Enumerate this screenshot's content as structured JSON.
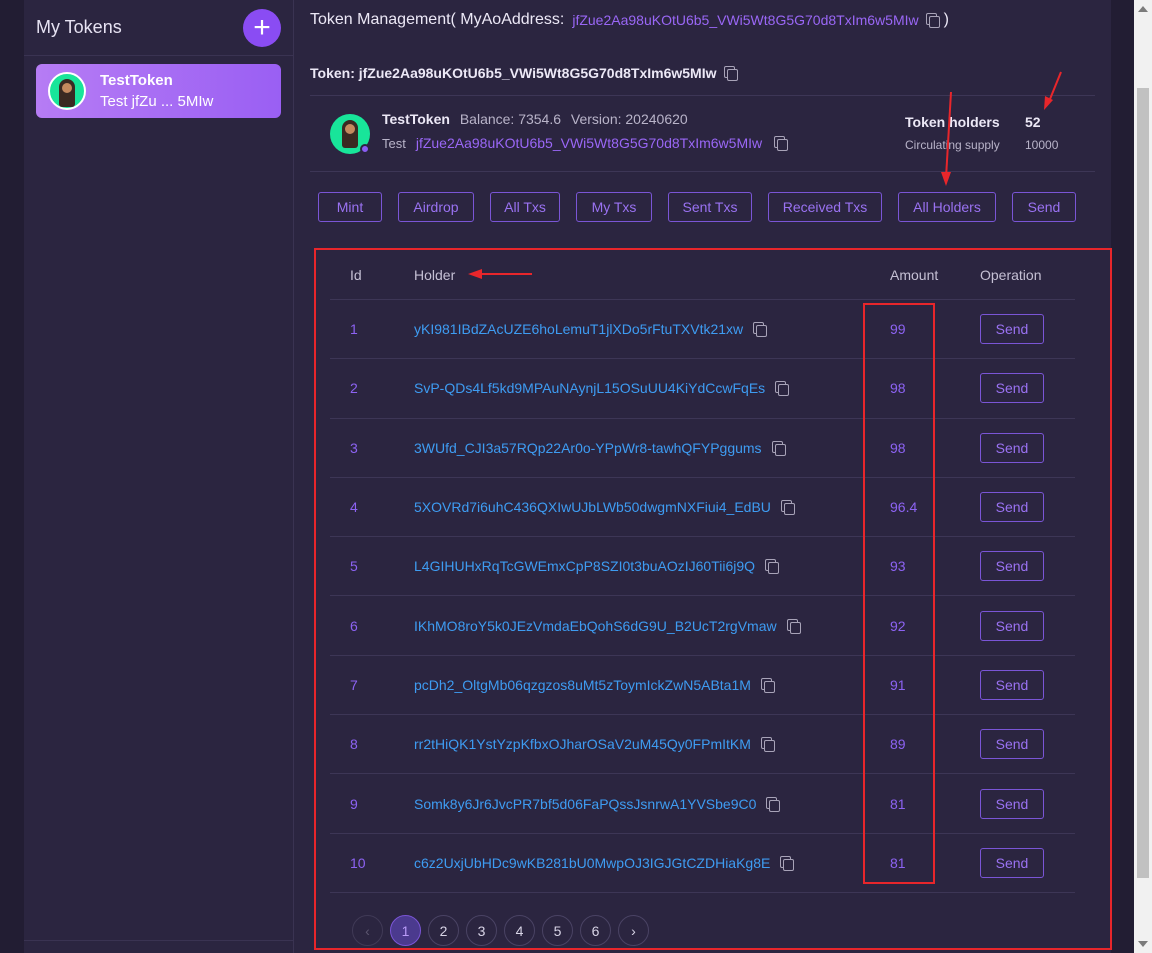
{
  "sidebar": {
    "title": "My Tokens",
    "add_label": "+",
    "items": [
      {
        "name": "TestToken",
        "subtitle": "Test jfZu ... 5MIw"
      }
    ]
  },
  "header": {
    "title_prefix": "Token Management( MyAoAddress:",
    "my_address": "jfZue2Aa98uKOtU6b5_VWi5Wt8G5G70d8TxIm6w5MIw",
    "title_suffix": ")"
  },
  "token_line": "Token: jfZue2Aa98uKOtU6b5_VWi5Wt8G5G70d8TxIm6w5MIw",
  "token_info": {
    "name": "TestToken",
    "balance": "Balance: 7354.6",
    "version": "Version: 20240620",
    "ticker": "Test",
    "address": "jfZue2Aa98uKOtU6b5_VWi5Wt8G5G70d8TxIm6w5MIw",
    "holders_label": "Token holders",
    "holders_value": "52",
    "supply_label": "Circulating supply",
    "supply_value": "10000"
  },
  "tabs": [
    "Mint",
    "Airdrop",
    "All Txs",
    "My Txs",
    "Sent Txs",
    "Received Txs",
    "All Holders",
    "Send"
  ],
  "table": {
    "headers": {
      "id": "Id",
      "holder": "Holder",
      "amount": "Amount",
      "operation": "Operation"
    },
    "send_label": "Send",
    "rows": [
      {
        "id": "1",
        "holder": "yKI981IBdZAcUZE6hoLemuT1jlXDo5rFtuTXVtk21xw",
        "amount": "99"
      },
      {
        "id": "2",
        "holder": "SvP-QDs4Lf5kd9MPAuNAynjL15OSuUU4KiYdCcwFqEs",
        "amount": "98"
      },
      {
        "id": "3",
        "holder": "3WUfd_CJI3a57RQp22Ar0o-YPpWr8-tawhQFYPggums",
        "amount": "98"
      },
      {
        "id": "4",
        "holder": "5XOVRd7i6uhC436QXIwUJbLWb50dwgmNXFiui4_EdBU",
        "amount": "96.4"
      },
      {
        "id": "5",
        "holder": "L4GIHUHxRqTcGWEmxCpP8SZI0t3buAOzIJ60Tii6j9Q",
        "amount": "93"
      },
      {
        "id": "6",
        "holder": "IKhMO8roY5k0JEzVmdaEbQohS6dG9U_B2UcT2rgVmaw",
        "amount": "92"
      },
      {
        "id": "7",
        "holder": "pcDh2_OltgMb06qzgzos8uMt5zToymIckZwN5ABta1M",
        "amount": "91"
      },
      {
        "id": "8",
        "holder": "rr2tHiQK1YstYzpKfbxOJharOSaV2uM45Qy0FPmItKM",
        "amount": "89"
      },
      {
        "id": "9",
        "holder": "Somk8y6Jr6JvcPR7bf5d06FaPQssJsnrwA1YVSbe9C0",
        "amount": "81"
      },
      {
        "id": "10",
        "holder": "c6z2UxjUbHDc9wKB281bU0MwpOJ3IGJGtCZDHiaKg8E",
        "amount": "81"
      }
    ]
  },
  "pagination": {
    "prev_icon": "‹",
    "next_icon": "›",
    "pages": [
      "1",
      "2",
      "3",
      "4",
      "5",
      "6"
    ],
    "current": "1"
  },
  "colors": {
    "accent": "#8a4cf3",
    "link": "#3e9cf2",
    "annotation": "#e8262b",
    "background": "#2b2540"
  }
}
